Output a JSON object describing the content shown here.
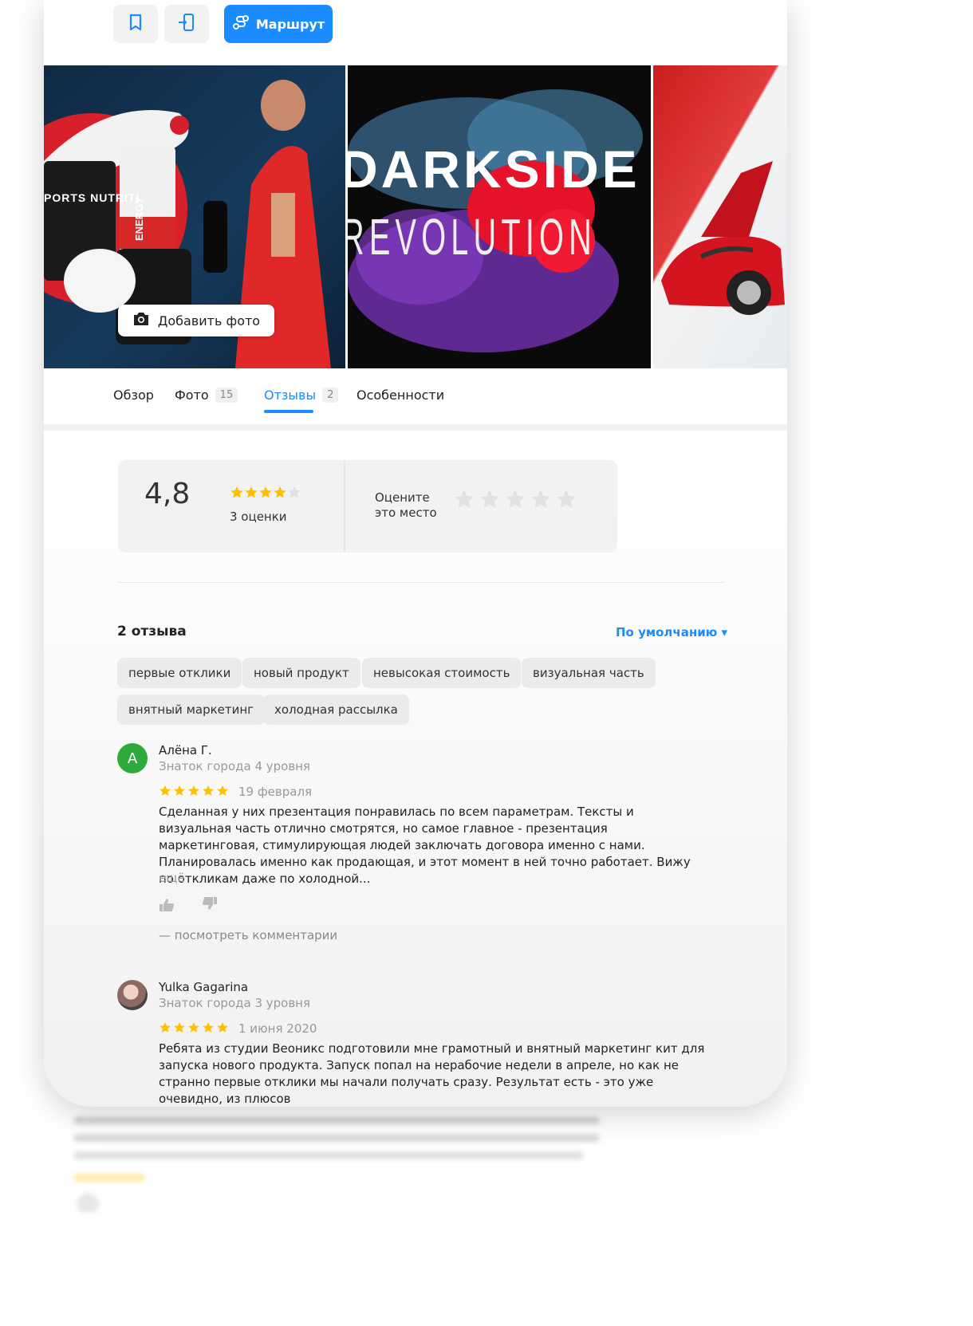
{
  "toolbar": {
    "bookmark_icon": "bookmark-icon",
    "send_to_phone_icon": "phone-send-icon",
    "route_label": "Маршрут",
    "route_icon": "route-icon"
  },
  "gallery": {
    "photos": [
      {
        "name": "photo-sports-nutrition",
        "text": "PORTS NUTRITI",
        "text2": "ENERGY"
      },
      {
        "name": "photo-darkside",
        "text": "DARKSIDE",
        "text2": "REVOLUTION"
      },
      {
        "name": "photo-red-car"
      }
    ],
    "add_photo_label": "Добавить фото"
  },
  "tabs": [
    {
      "label": "Обзор",
      "count": ""
    },
    {
      "label": "Фото",
      "count": "15"
    },
    {
      "label": "Отзывы",
      "count": "2",
      "active": true
    },
    {
      "label": "Особенности",
      "count": ""
    }
  ],
  "rating": {
    "value": "4,8",
    "stars": 4.8,
    "count_label": "3 оценки",
    "rate_prompt_line1": "Оцените",
    "rate_prompt_line2": "это место"
  },
  "reviews_header": {
    "title": "2 отзыва",
    "sort_label": "По умолчанию ▾"
  },
  "tags": [
    "первые отклики",
    "новый продукт",
    "невысокая стоимость",
    "визуальная часть",
    "внятный маркетинг",
    "холодная рассылка"
  ],
  "reviews": [
    {
      "avatar_letter": "А",
      "name": "Алёна Г.",
      "level": "Знаток города 4 уровня",
      "stars": 5,
      "date": "19 февраля",
      "text": "Сделанная у них презентация понравилась по всем параметрам. Тексты и визуальная часть отлично смотрятся, но самое главное - презентация маркетинговая, стимулирующая людей заключать договора именно с нами. Планировалась именно как продающая, и этот момент в ней точно работает. Вижу по откликам даже по холодной...",
      "more": "ещё",
      "comments": "— посмотреть комментарии"
    },
    {
      "name": "Yulka Gagarina",
      "level": "Знаток города 3 уровня",
      "stars": 5,
      "date": "1 июня 2020",
      "text": "Ребята из студии Веоникс подготовили мне грамотный и внятный маркетинг кит для запуска нового продукта. Запуск попал на нерабочие недели в апреле, но как не странно первые отклики мы начали получать сразу. Результат есть - это уже очевидно, из плюсов"
    }
  ],
  "colors": {
    "accent": "#1a8cff",
    "star": "#ffc000",
    "avatar_green": "#2eaa3c"
  }
}
